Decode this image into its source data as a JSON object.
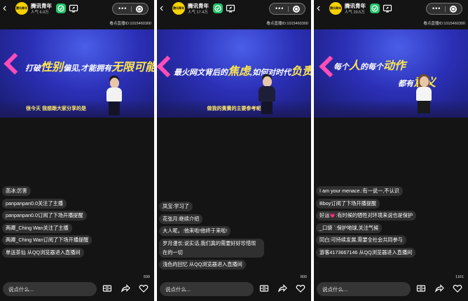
{
  "panels": [
    {
      "account_name": "腾讯青年",
      "popularity": "人气 6.0万",
      "avatar_text": "腾讯青年",
      "room_id": "看点直播ID:1015460300",
      "video": {
        "slogan_1": "打破",
        "slogan_2": "性别",
        "slogan_3": "偏见,才能拥有",
        "slogan_4": "无限可能",
        "subtitle": "很今天 我想跟大家分享的是"
      },
      "messages": [
        {
          "user": "",
          "text": "菡冰:厉害"
        },
        {
          "user": "",
          "text": "panpanpan0.0关注了主播"
        },
        {
          "user": "",
          "text": "panpanpan0.0订阅了下场开播提醒"
        },
        {
          "user": "",
          "text": "两卿_Ching Wan关注了主播"
        },
        {
          "user": "",
          "text": "两卿_Ching Wan订阅了下场开播提醒"
        },
        {
          "user": "",
          "text": "单送茶仙 从QQ浏览器进入直播间"
        }
      ],
      "input_placeholder": "说点什么...",
      "like_count": "599"
    },
    {
      "account_name": "腾讯青年",
      "popularity": "人气 17.4万",
      "avatar_text": "腾讯青年",
      "room_id": "看点直播ID:1015460300",
      "video": {
        "slogan_1": "最火网文背后的",
        "slogan_2": "焦虑",
        "slogan_3": ",如何对时代",
        "slogan_4": "负责",
        "subtitle": "做我的責費的主要参考呢"
      },
      "messages": [
        {
          "user": "",
          "text": "凤宝:学习了"
        },
        {
          "user": "",
          "text": "花弦月:继续介绍"
        },
        {
          "user": "",
          "text": "大人呢。:他来啦!他终于来啦!"
        },
        {
          "user": "",
          "text": "岁月漫长:说实话,我们真的需要好好珍惜现在的一切"
        },
        {
          "user": "",
          "text": "浅色的回忆 从QQ浏览器进入直播间"
        }
      ],
      "input_placeholder": "说点什么...",
      "like_count": "800"
    },
    {
      "account_name": "腾讯青年",
      "popularity": "人气 29.5万",
      "avatar_text": "腾讯青年",
      "room_id": "看点直播ID:1015460300",
      "video": {
        "slogan_1": "每个",
        "slogan_2": "人",
        "slogan_3": "的每个",
        "slogan_4": "动作",
        "slogan_5": "都有",
        "slogan_6": "意义",
        "subtitle": ""
      },
      "messages": [
        {
          "user": "",
          "text": "I am your menace.:有一说一,不认识"
        },
        {
          "user": "",
          "text": "Bboy订阅了下场开播提醒"
        },
        {
          "user": "",
          "text": "好运💗:有时候的牺牲对环境来说也是保护"
        },
        {
          "user": "",
          "text": "_口袋 `:保护地球,关注气候"
        },
        {
          "user": "",
          "text": "同白:可持续发展,需要全社会共同参与"
        },
        {
          "user": "",
          "text": "游客4173667146 从QQ浏览器进入直播间"
        }
      ],
      "input_placeholder": "说点什么...",
      "like_count": "1161"
    }
  ],
  "icons": {
    "back": "back-arrow-icon",
    "follow": "follow-check-icon",
    "share_screen": "screen-share-icon",
    "more": "more-dots-icon",
    "close_target": "target-close-icon",
    "coupon": "coupon-icon",
    "share": "share-arrow-icon",
    "like": "heart-icon"
  },
  "colors": {
    "follow_green": "#22c36b",
    "slogan_yellow": "#ffe84a",
    "accent_pink": "#ff4db8",
    "stage_blue": "#2b2fb6"
  }
}
